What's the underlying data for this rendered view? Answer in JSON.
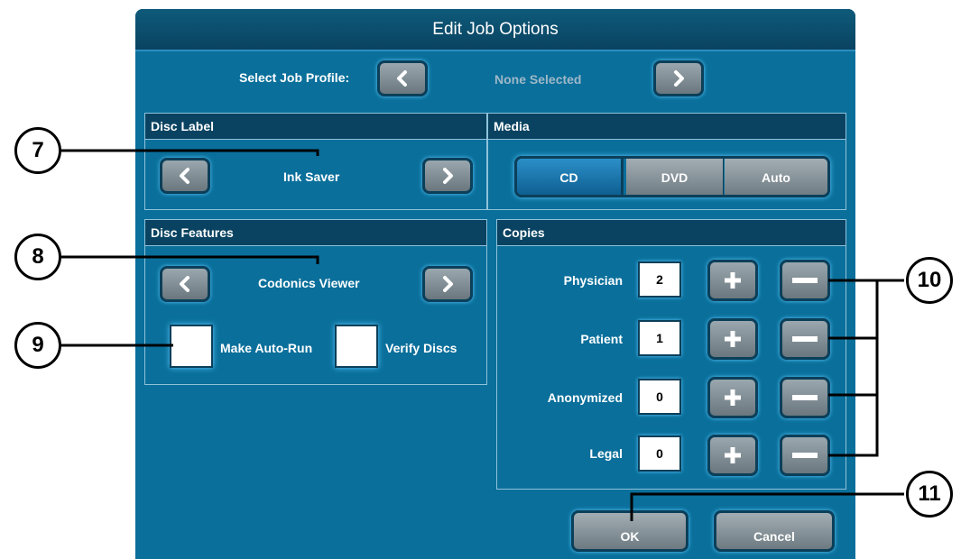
{
  "dialog": {
    "title": "Edit Job Options"
  },
  "profile": {
    "label": "Select Job Profile:",
    "value": "None Selected"
  },
  "disc_label": {
    "title": "Disc Label",
    "value": "Ink Saver"
  },
  "media": {
    "title": "Media",
    "options": [
      "CD",
      "DVD",
      "Auto"
    ],
    "selected": "CD"
  },
  "disc_features": {
    "title": "Disc Features",
    "value": "Codonics Viewer",
    "make_autorun": "Make Auto-Run",
    "verify_discs": "Verify Discs"
  },
  "copies": {
    "title": "Copies",
    "rows": [
      {
        "label": "Physician",
        "value": "2"
      },
      {
        "label": "Patient",
        "value": "1"
      },
      {
        "label": "Anonymized",
        "value": "0"
      },
      {
        "label": "Legal",
        "value": "0"
      }
    ]
  },
  "buttons": {
    "ok": "OK",
    "cancel": "Cancel"
  },
  "callouts": {
    "c7": "7",
    "c8": "8",
    "c9": "9",
    "c10": "10",
    "c11": "11"
  },
  "icons": {
    "left": "chevron-left-icon",
    "right": "chevron-right-icon",
    "plus": "plus-icon",
    "minus": "minus-icon"
  },
  "colors": {
    "dialog_bg": "#0a6f9b",
    "header_bg": "#0a4361",
    "selected_segment": "#1f7fb8"
  }
}
